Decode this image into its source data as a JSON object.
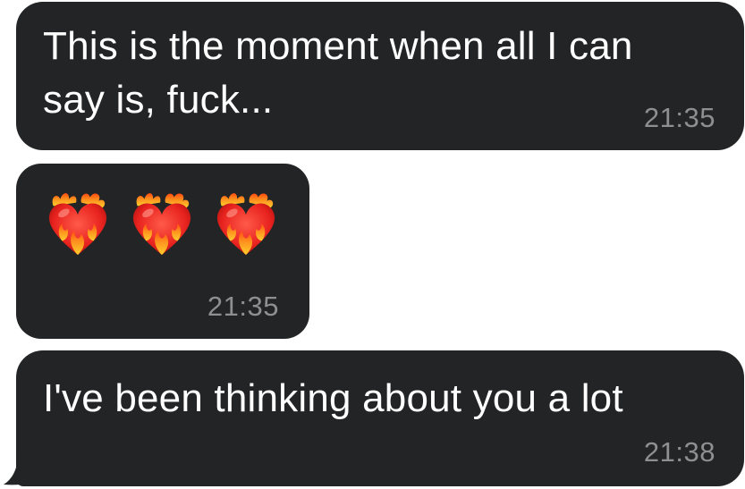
{
  "messages": [
    {
      "id": "msg1",
      "lines": [
        "This is the moment when all I can",
        "say is, fuck..."
      ],
      "time": "21:35"
    },
    {
      "id": "msg2",
      "emoji": [
        "heart-on-fire-icon",
        "heart-on-fire-icon",
        "heart-on-fire-icon"
      ],
      "time": "21:35"
    },
    {
      "id": "msg3",
      "lines": [
        "I've been thinking about you a lot"
      ],
      "time": "21:38"
    }
  ],
  "colors": {
    "bubble": "#222425",
    "text": "#ffffff",
    "timestamp": "#8e8e93",
    "background": "#ffffff"
  }
}
